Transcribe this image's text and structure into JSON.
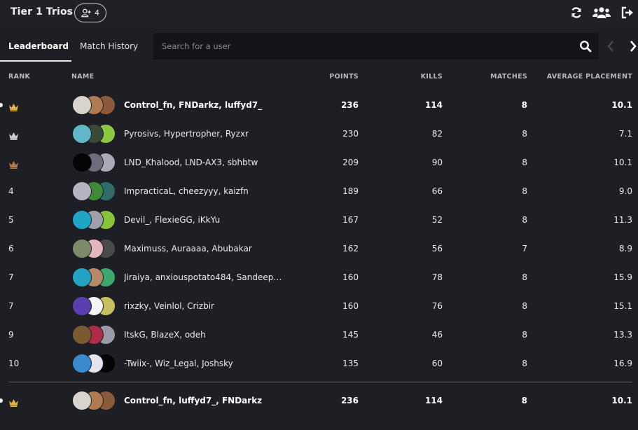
{
  "header": {
    "title": "Tier 1 Trios",
    "member_count": "4",
    "icons": [
      "user-plus-icon",
      "refresh-icon",
      "users-icon",
      "logout-icon"
    ]
  },
  "tabs": [
    {
      "label": "Leaderboard",
      "active": true
    },
    {
      "label": "Match History",
      "active": false
    }
  ],
  "search": {
    "placeholder": "Search for a user",
    "value": ""
  },
  "columns": {
    "rank": "RANK",
    "name": "NAME",
    "points": "POINTS",
    "kills": "KILLS",
    "matches": "MATCHES",
    "avg": "AVERAGE PLACEMENT"
  },
  "colors": {
    "gold": "#e2b247",
    "silver": "#d0d0d4",
    "bronze": "#b77a4b",
    "background": "#1e1f24",
    "search_bg": "#131417"
  },
  "rows": [
    {
      "rank": "1",
      "medal": "gold",
      "highlight": true,
      "names": "Control_fn, FNDarkz, luffyd7_",
      "points": "236",
      "kills": "114",
      "matches": "8",
      "avg": "10.1",
      "avatars": [
        "#d8d4cc",
        "#b07a52",
        "#8a5a3a"
      ]
    },
    {
      "rank": "2",
      "medal": "silver",
      "highlight": false,
      "names": "Pyrosivs, Hypertropher, Ryzxr",
      "points": "230",
      "kills": "82",
      "matches": "8",
      "avg": "7.1",
      "avatars": [
        "#5fb7c9",
        "#3a4a3a",
        "#8dc63f"
      ]
    },
    {
      "rank": "3",
      "medal": "bronze",
      "highlight": false,
      "names": "LND_Khalood, LND-AX3, sbhbtw",
      "points": "209",
      "kills": "90",
      "matches": "8",
      "avg": "10.1",
      "avatars": [
        "#050505",
        "#6c6c7a",
        "#a9a9b8"
      ]
    },
    {
      "rank": "4",
      "medal": "",
      "highlight": false,
      "names": "ImpracticaL, cheezyyy, kaizfn",
      "points": "189",
      "kills": "66",
      "matches": "8",
      "avg": "9.0",
      "avatars": [
        "#b3b3c2",
        "#3e8a3a",
        "#2e6b6a"
      ]
    },
    {
      "rank": "5",
      "medal": "",
      "highlight": false,
      "names": "Devil_, FlexieGG, iKkYu",
      "points": "167",
      "kills": "52",
      "matches": "8",
      "avg": "11.3",
      "avatars": [
        "#1fa6c4",
        "#a0a0ad",
        "#87c23a"
      ]
    },
    {
      "rank": "6",
      "medal": "",
      "highlight": false,
      "names": "Maximuss, Auraaaa, Abubakar",
      "points": "162",
      "kills": "56",
      "matches": "7",
      "avg": "8.9",
      "avatars": [
        "#7d8a6a",
        "#e6b6be",
        "#4a4a4a"
      ]
    },
    {
      "rank": "7",
      "medal": "",
      "highlight": false,
      "names": "Jiraiya, anxiouspotato484, Sandeep…",
      "points": "160",
      "kills": "78",
      "matches": "8",
      "avg": "15.9",
      "avatars": [
        "#21a4c2",
        "#b48a6a",
        "#3aa870"
      ]
    },
    {
      "rank": "7",
      "medal": "",
      "highlight": false,
      "names": "rixzky, Veinlol, Crizbir",
      "points": "160",
      "kills": "76",
      "matches": "8",
      "avg": "15.1",
      "avatars": [
        "#5a3fb2",
        "#f4f4f4",
        "#c8c060"
      ]
    },
    {
      "rank": "9",
      "medal": "",
      "highlight": false,
      "names": "ItskG, BlazeX, odeh",
      "points": "145",
      "kills": "46",
      "matches": "8",
      "avg": "13.3",
      "avatars": [
        "#7a5a30",
        "#b02a4a",
        "#9a9aa6"
      ]
    },
    {
      "rank": "10",
      "medal": "",
      "highlight": false,
      "names": "-Twiix-, Wiz_Legal, Joshsky",
      "points": "135",
      "kills": "60",
      "matches": "8",
      "avg": "16.9",
      "avatars": [
        "#3a8ad0",
        "#e4e4ee",
        "#050505"
      ]
    }
  ],
  "own_team": {
    "rank": "1",
    "medal": "gold",
    "highlight": true,
    "names": "Control_fn, luffyd7_, FNDarkz",
    "points": "236",
    "kills": "114",
    "matches": "8",
    "avg": "10.1",
    "avatars": [
      "#d8d4cc",
      "#b07a52",
      "#8a5a3a"
    ]
  }
}
